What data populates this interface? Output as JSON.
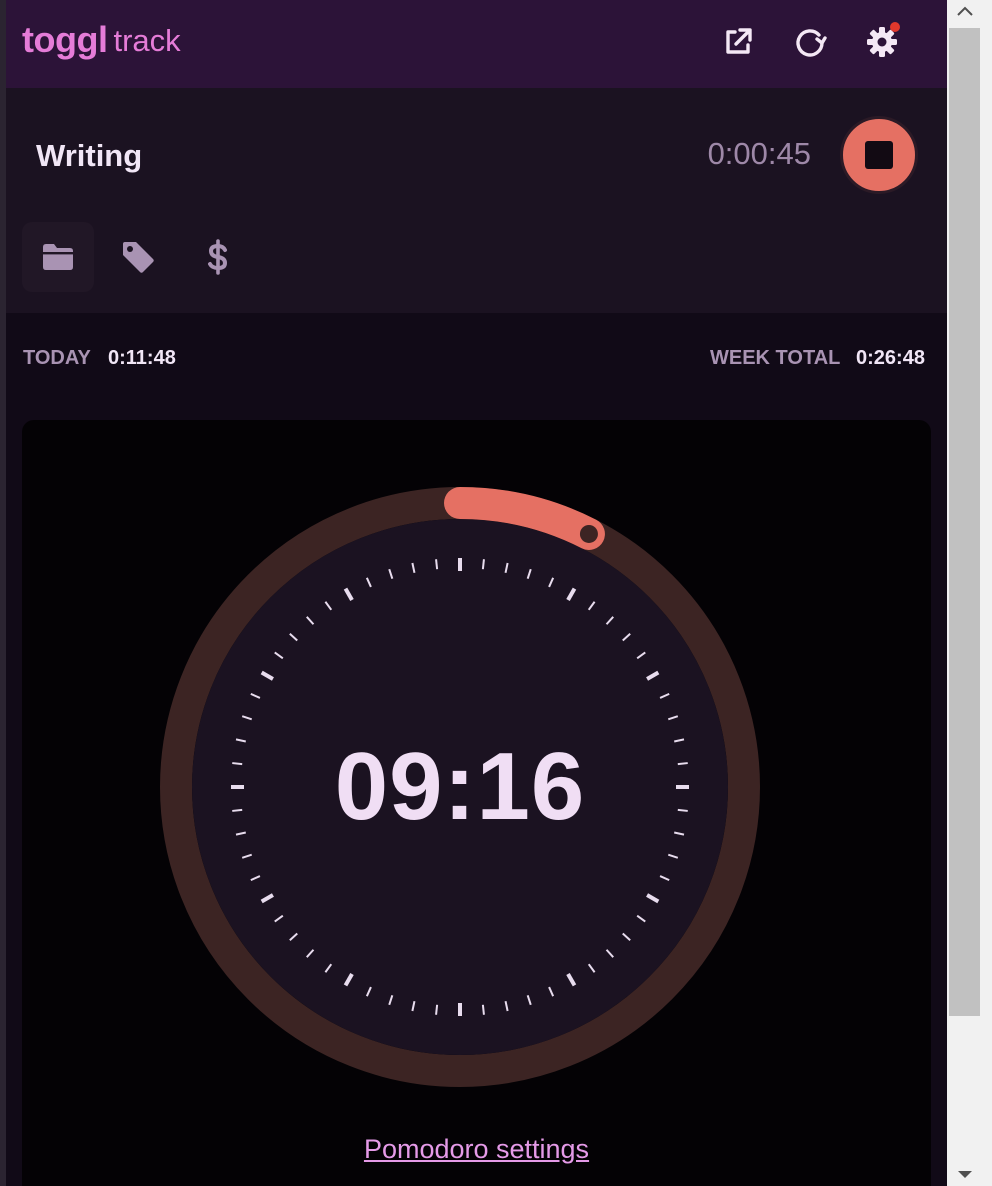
{
  "header": {
    "logo_primary": "toggl",
    "logo_secondary": "track",
    "buttons": [
      {
        "name": "open-external-icon"
      },
      {
        "name": "sync-icon"
      },
      {
        "name": "settings-gear-icon",
        "has_notification": true
      }
    ]
  },
  "timer": {
    "description": "Writing",
    "elapsed": "0:00:45",
    "stop_icon": "stop-icon",
    "meta_icons": [
      "folder-icon",
      "tag-icon",
      "dollar-icon"
    ]
  },
  "totals": {
    "today_label": "TODAY",
    "today_value": "0:11:48",
    "week_label": "WEEK TOTAL",
    "week_value": "0:26:48"
  },
  "pomodoro": {
    "countdown": "09:16",
    "progress_fraction": 0.075,
    "settings_link": "Pomodoro settings"
  },
  "colors": {
    "brand": "#e57cd8",
    "header_bg": "#2c1338",
    "stop": "#e57063",
    "ring_track": "#3c2423",
    "dial_face": "#1b1221"
  }
}
